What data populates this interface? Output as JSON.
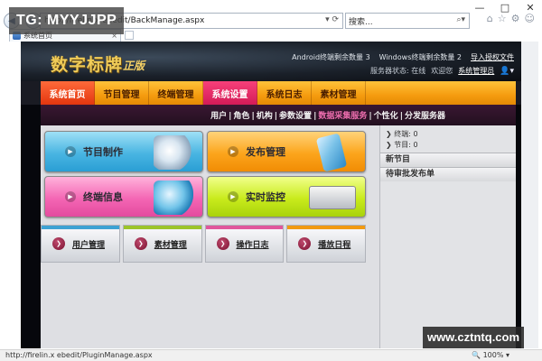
{
  "watermarks": {
    "top_left": "TG: MYYJJPP",
    "bottom_right": "www.cztntq.com"
  },
  "browser": {
    "address": "http://firelin.x        ebedit/BackManage.aspx",
    "addr_tools": "▾ ⟳",
    "search_placeholder": "搜索...",
    "search_icon": "⌕▾",
    "tab_title": "系统首页",
    "tab_close": "×",
    "window_controls": {
      "minimize": "—",
      "maximize": "□",
      "close": "✕"
    },
    "nav": {
      "back": "◀",
      "forward": "▶"
    },
    "toolbar_icons": [
      "⌂",
      "☆",
      "⚙",
      "☺"
    ]
  },
  "header": {
    "logo": "数字标牌",
    "version": "正版",
    "android_status": "Android终端剩余数量 3",
    "windows_status": "Windows终端剩余数量 2",
    "import_license": "导入授权文件",
    "server_status": "服务器状态: 在线",
    "welcome": "欢迎您",
    "user": "系统管理员",
    "user_icon": "👤▾"
  },
  "main_nav": [
    "系统首页",
    "节目管理",
    "终端管理",
    "系统设置",
    "系统日志",
    "素材管理"
  ],
  "sub_nav": [
    "用户",
    "角色",
    "机构",
    "参数设置",
    "数据采集服务",
    "个性化",
    "分发服务器"
  ],
  "tiles": [
    "节目制作",
    "发布管理",
    "终端信息",
    "实时监控"
  ],
  "quick_links": [
    {
      "label": "用户管理",
      "color": "#3ea2d3"
    },
    {
      "label": "素材管理",
      "color": "#9cc42a"
    },
    {
      "label": "操作日志",
      "color": "#e0569c"
    },
    {
      "label": "播放日程",
      "color": "#f19a12"
    }
  ],
  "side": {
    "terminal": "❯ 终端: 0",
    "program": "❯ 节目: 0",
    "new_program": "新节目",
    "pending_publish": "待审批发布单"
  },
  "status_bar": {
    "url": "http://firelin.x        ebedit/PluginManage.aspx",
    "zoom": "🔍 100% ▾"
  }
}
